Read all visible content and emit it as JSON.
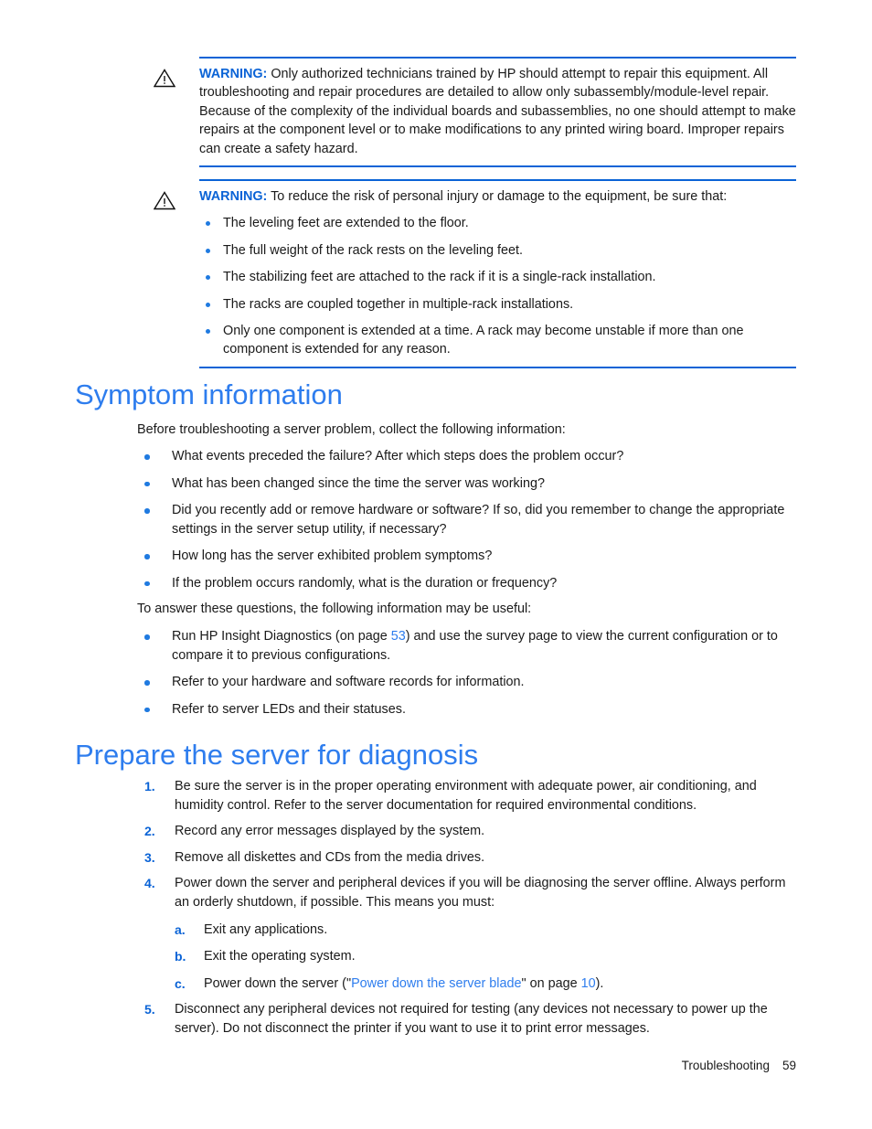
{
  "document": {
    "footer_section": "Troubleshooting",
    "footer_page": "59"
  },
  "colors": {
    "heading_blue": "#2e7dee",
    "rule_blue": "#0a63d6",
    "label_blue": "#0a63d6",
    "bullet_blue": "#1f7ae0",
    "link_blue": "#2e7dee",
    "body_text": "#1a1a1a"
  },
  "warnings": [
    {
      "icon": "warning-triangle-icon",
      "label": "WARNING:",
      "text": "Only authorized technicians trained by HP should attempt to repair this equipment. All troubleshooting and repair procedures are detailed to allow only subassembly/module-level repair. Because of the complexity of the individual boards and subassemblies, no one should attempt to make repairs at the component level or to make modifications to any printed wiring board. Improper repairs can create a safety hazard.",
      "items": []
    },
    {
      "icon": "warning-triangle-icon",
      "label": "WARNING:",
      "text": "To reduce the risk of personal injury or damage to the equipment, be sure that:",
      "items": [
        "The leveling feet are extended to the floor.",
        "The full weight of the rack rests on the leveling feet.",
        "The stabilizing feet are attached to the rack if it is a single-rack installation.",
        "The racks are coupled together in multiple-rack installations.",
        "Only one component is extended at a time. A rack may become unstable if more than one component is extended for any reason."
      ]
    }
  ],
  "symptom_section": {
    "heading": "Symptom information",
    "intro": "Before troubleshooting a server problem, collect the following information:",
    "questions": [
      "What events preceded the failure? After which steps does the problem occur?",
      "What has been changed since the time the server was working?",
      "Did you recently add or remove hardware or software? If so, did you remember to change the appropriate settings in the server setup utility, if necessary?",
      "How long has the server exhibited problem symptoms?",
      "If the problem occurs randomly, what is the duration or frequency?"
    ],
    "answer_intro": "To answer these questions, the following information may be useful:",
    "resources": {
      "item1_pre": "Run HP Insight Diagnostics (on page ",
      "item1_link": "53",
      "item1_post": ") and use the survey page to view the current configuration or to compare it to previous configurations.",
      "item2": "Refer to your hardware and software records for information.",
      "item3": "Refer to server LEDs and their statuses."
    }
  },
  "prepare_section": {
    "heading": "Prepare the server for diagnosis",
    "steps": [
      {
        "marker": "1.",
        "text": "Be sure the server is in the proper operating environment with adequate power, air conditioning, and humidity control. Refer to the server documentation for required environmental conditions."
      },
      {
        "marker": "2.",
        "text": "Record any error messages displayed by the system."
      },
      {
        "marker": "3.",
        "text": "Remove all diskettes and CDs from the media drives."
      },
      {
        "marker": "4.",
        "text": "Power down the server and peripheral devices if you will be diagnosing the server offline. Always perform an orderly shutdown, if possible. This means you must:",
        "substeps": [
          {
            "marker": "a.",
            "text": "Exit any applications."
          },
          {
            "marker": "b.",
            "text": "Exit the operating system."
          },
          {
            "marker": "c.",
            "pre": "Power down the server (\"",
            "link": "Power down the server blade",
            "mid": "\" on page ",
            "link2": "10",
            "post": ")."
          }
        ]
      },
      {
        "marker": "5.",
        "text": "Disconnect any peripheral devices not required for testing (any devices not necessary to power up the server). Do not disconnect the printer if you want to use it to print error messages."
      }
    ]
  }
}
